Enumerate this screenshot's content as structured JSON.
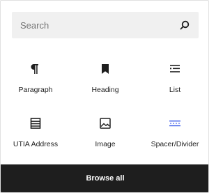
{
  "search": {
    "placeholder": "Search",
    "icon": "search-icon"
  },
  "blocks": [
    {
      "label": "Paragraph",
      "icon": "paragraph-icon"
    },
    {
      "label": "Heading",
      "icon": "bookmark-icon"
    },
    {
      "label": "List",
      "icon": "list-icon"
    },
    {
      "label": "UTIA Address",
      "icon": "table-list-icon"
    },
    {
      "label": "Image",
      "icon": "image-icon"
    },
    {
      "label": "Spacer/Divider",
      "icon": "spacer-divider-icon"
    }
  ],
  "footer": {
    "browse_all_label": "Browse all"
  },
  "colors": {
    "text": "#1e1e1e",
    "search_bg": "#f0f0f0",
    "footer_bg": "#1e1e1e",
    "accent": "#3858e9"
  }
}
